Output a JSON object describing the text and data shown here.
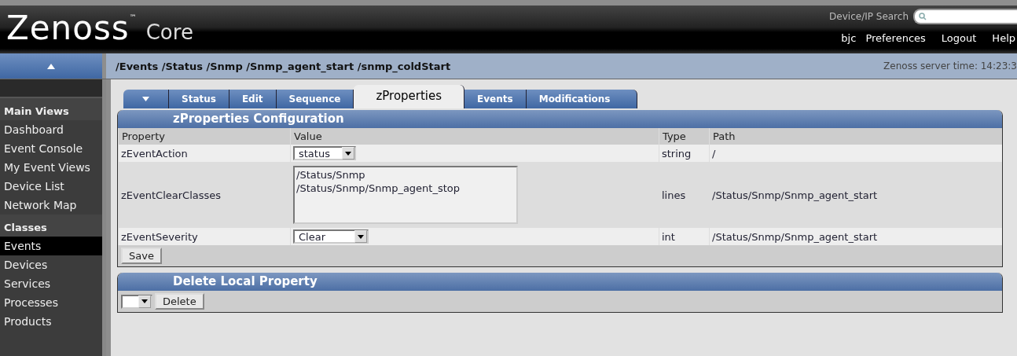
{
  "header": {
    "logo": {
      "name": "Zenoss",
      "mark": "™",
      "product": "Core"
    },
    "search": {
      "label": "Device/IP Search"
    },
    "user": "bjc",
    "links": [
      "Preferences",
      "Logout",
      "Help"
    ]
  },
  "breadcrumb": "/Events /Status /Snmp /Snmp_agent_start /snmp_coldStart",
  "server_time": "Zenoss server time: 14:23:3",
  "sidebar": [
    {
      "title": "Main Views",
      "items": [
        {
          "label": "Dashboard",
          "selected": false
        },
        {
          "label": "Event Console",
          "selected": false
        },
        {
          "label": "My Event Views",
          "selected": false
        },
        {
          "label": "Device List",
          "selected": false
        },
        {
          "label": "Network Map",
          "selected": false
        }
      ]
    },
    {
      "title": "Classes",
      "items": [
        {
          "label": "Events",
          "selected": true
        },
        {
          "label": "Devices",
          "selected": false
        },
        {
          "label": "Services",
          "selected": false
        },
        {
          "label": "Processes",
          "selected": false
        },
        {
          "label": "Products",
          "selected": false
        }
      ]
    }
  ],
  "tabs": [
    {
      "label": "Status",
      "selected": false
    },
    {
      "label": "Edit",
      "selected": false
    },
    {
      "label": "Sequence",
      "selected": false
    },
    {
      "label": "zProperties",
      "selected": true
    },
    {
      "label": "Events",
      "selected": false
    },
    {
      "label": "Modifications",
      "selected": false
    }
  ],
  "config": {
    "title": "zProperties Configuration",
    "columns": [
      "Property",
      "Value",
      "Type",
      "Path"
    ],
    "rows": [
      {
        "property": "zEventAction",
        "value": {
          "kind": "select",
          "text": "status"
        },
        "type": "string",
        "path": "/"
      },
      {
        "property": "zEventClearClasses",
        "value": {
          "kind": "textarea",
          "lines": [
            "/Status/Snmp",
            "/Status/Snmp/Snmp_agent_stop"
          ]
        },
        "type": "lines",
        "path": "/Status/Snmp/Snmp_agent_start"
      },
      {
        "property": "zEventSeverity",
        "value": {
          "kind": "select",
          "text": "Clear"
        },
        "type": "int",
        "path": "/Status/Snmp/Snmp_agent_start"
      }
    ],
    "button": "Save"
  },
  "delete": {
    "title": "Delete Local Property",
    "button": "Delete"
  }
}
